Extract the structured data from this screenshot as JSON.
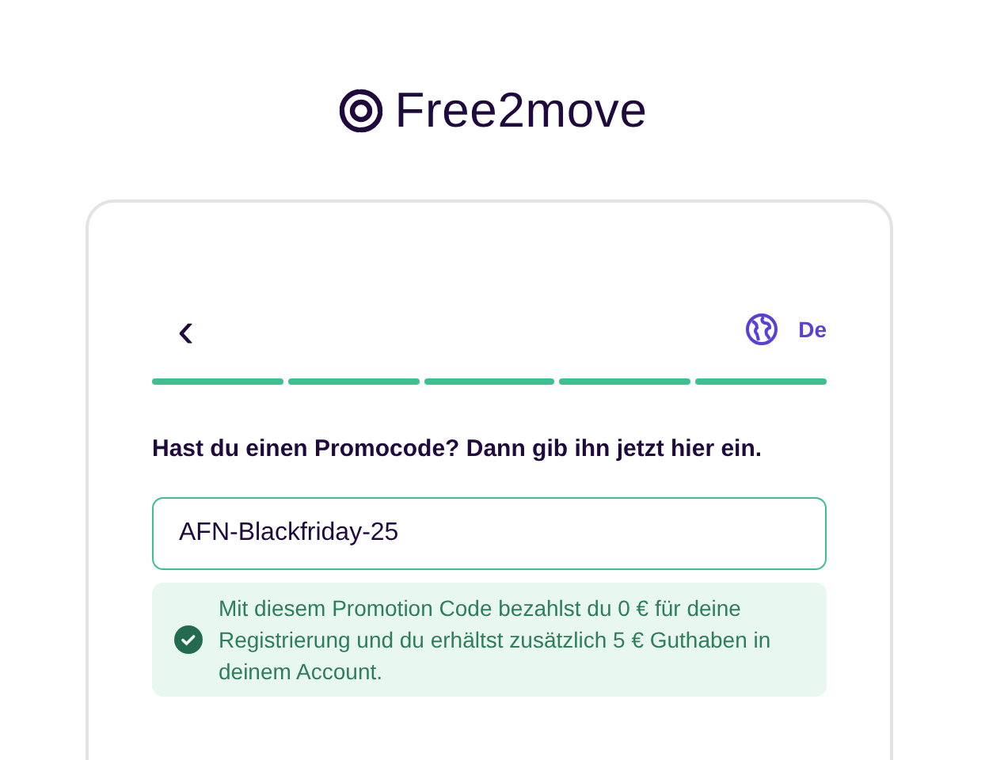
{
  "logo": {
    "text": "Free2move"
  },
  "header": {
    "back": "‹",
    "language": "De"
  },
  "progress": [
    {
      "done": true
    },
    {
      "done": true
    },
    {
      "done": true
    },
    {
      "done": true
    },
    {
      "done": true
    }
  ],
  "question": "Hast du einen Promocode? Dann gib ihn jetzt hier ein.",
  "promo_field": {
    "value": "AFN-Blackfriday-25"
  },
  "success_message": "Mit diesem Promotion Code bezahlst du 0 € für deine Registrierung und du erhältst zusätzlich 5 € Guthaben in deinem Account."
}
